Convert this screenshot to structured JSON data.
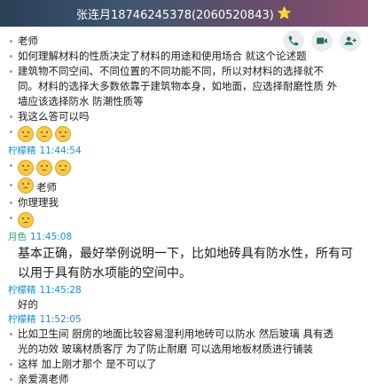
{
  "header": {
    "title": "张连月18746245378(2060520843)",
    "star": "⭐"
  },
  "actions": [
    {
      "name": "phone-icon"
    },
    {
      "name": "video-icon"
    },
    {
      "name": "add-member-icon"
    }
  ],
  "messages": {
    "m1": "老师",
    "m2": "如何理解材料的性质决定了材料的用途和使用场合 就这个论述题",
    "m3": "建筑物不同空间、不同位置的不同功能不同，所以对材料的选择就不同。材料的选择大多数依靠于建筑物本身，如地面，应选择耐磨性质 外墙应该选择防水 防潮性质等",
    "m4": "我这么答可以吗",
    "s1": {
      "name": "柠檬精",
      "time": "11:44:54"
    },
    "m5": "老师",
    "m6": "你理理我",
    "s2": {
      "name": "月色",
      "time": "11:45:08"
    },
    "m7": "基本正确，最好举例说明一下，比如地砖具有防水性，所有可以用于具有防水项能的空间中。",
    "s3": {
      "name": "柠檬精",
      "time": "11:45:28"
    },
    "m8": "好的",
    "s4": {
      "name": "柠檬精",
      "time": "11:52:05"
    },
    "m9": "比如卫生间 厨房的地面比较容易湿利用地砖可以防水 然后玻璃 具有透光的功效 玻璃材质客厅 为了防止耐磨 可以选用地板材质进行铺装",
    "m10": "这样 加上刚才那个 是不可以了",
    "m11": "亲爱滴老师"
  }
}
